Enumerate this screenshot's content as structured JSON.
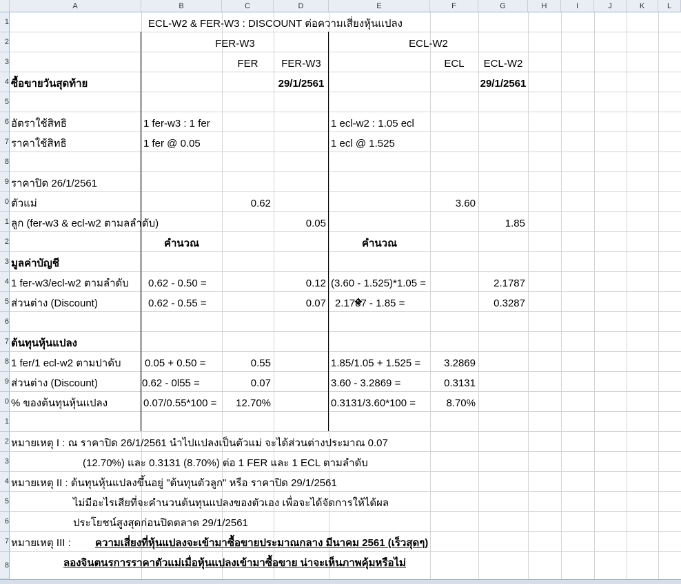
{
  "columns": [
    "A",
    "B",
    "C",
    "D",
    "E",
    "F",
    "G",
    "H",
    "I",
    "J",
    "K",
    "L"
  ],
  "rows": [
    "1",
    "2",
    "3",
    "4",
    "5",
    "6",
    "7",
    "8",
    "9",
    "0",
    "1",
    "2",
    "3",
    "4",
    "5",
    "6",
    "7",
    "8",
    "9",
    "0",
    "1",
    "2",
    "3",
    "4",
    "5",
    "6",
    "7",
    "8"
  ],
  "cells": {
    "title": "ECL-W2 & FER-W3 : DISCOUNT ต่อความเสี่ยงหุ้นแปลง",
    "fer_w3_group": "FER-W3",
    "ecl_w2_group": "ECL-W2",
    "fer_hdr": "FER",
    "fer_w3_hdr": "FER-W3",
    "ecl_hdr": "ECL",
    "ecl_w2_hdr": "ECL-W2",
    "last_trade_label": "ซื้อขายวันสุดท้าย",
    "last_trade_fer": "29/1/2561",
    "last_trade_ecl": "29/1/2561",
    "ratio_label": "อัตราใช้สิทธิ",
    "ratio_fer": "1 fer-w3 : 1 fer",
    "ratio_ecl": "1 ecl-w2 : 1.05 ecl",
    "price_label": "ราคาใช้สิทธิ",
    "price_fer": "1 fer @ 0.05",
    "price_ecl": "1 ecl @ 1.525",
    "close_label": "ราคาปิด   26/1/2561",
    "mother_label": "ตัวแม่",
    "mother_fer": "0.62",
    "mother_ecl": "3.60",
    "child_label": "ลูก   (fer-w3 & ecl-w2 ตามลลำดับ)",
    "child_fer": "0.05",
    "child_ecl": "1.85",
    "calc_fer": "คำนวณ",
    "calc_ecl": "คำนวณ",
    "book_label": "มูลค่าบัญชี",
    "book_row_label": "1 fer-w3/ecl-w2 ตามลำดับ",
    "book_fer_formula": "0.62 -  0.50   =",
    "book_fer_val": "0.12",
    "book_ecl_formula": "(3.60 - 1.525)*1.05 =",
    "book_ecl_val": "2.1787",
    "disc_label": "ส่วนต่าง   (Discount)",
    "disc_fer_formula": "0.62 - 0.55   =",
    "disc_fer_val": "0.07",
    "disc_ecl_formula": "2.1787 - 1.85       =",
    "disc_ecl_val": "0.3287",
    "cost_label": "ต้นทุนหุ้นแปลง",
    "cost_row_label": "1 fer/1 ecl-w2 ตามปาดับ",
    "cost_fer_formula": "0.05 + 0.50    =",
    "cost_fer_val": "0.55",
    "cost_ecl_formula": "1.85/1.05 + 1.525 =",
    "cost_ecl_val": "3.2869",
    "disc2_label": "ส่วนต่าง   (Discount)",
    "disc2_fer_formula": "0.62 - 0l55     =",
    "disc2_fer_val": "0.07",
    "disc2_ecl_formula": "3.60 - 3.2869          =",
    "disc2_ecl_val": "0.3131",
    "pct_label": "% ของต้นทุนหุ้นแปลง",
    "pct_fer_formula": "0.07/0.55*100 =",
    "pct_fer_val": "12.70%",
    "pct_ecl_formula": "0.3131/3.60*100  =",
    "pct_ecl_val": "8.70%",
    "note1_a": "หมายเหตุ   I :  ณ    ราคาปิด   26/1/2561 นำไปแปลงเป็นตัวแม่   จะได้ส่วนต่างประมาณ   0.07",
    "note1_b": "(12.70%) และ   0.3131 (8.70%)  ต่อ   1 FER  และ   1 ECL ตามลำดับ",
    "note2_a": "หมายเหตุ   II :  ต้นทุนหุ้นแปลงขึ้นอยู่   \"ต้นทุนตัวลูก\"  หรือ   ราคาปิด   29/1/2561",
    "note2_b": "ไม่มีอะไรเสียที่จะคำนวนต้นทุนแปลงของตัวเอง   เพื่อจะได้จัดการให้ได้ผล",
    "note2_c": "ประโยชน์สูงสุดก่อนปิดตลาด   29/1/2561",
    "note3_prefix": "หมายเหตุ   III :",
    "note3_a": "ความเสี่ยงที่หุ้นแปลงจะเข้ามาซื้อขายประมาณกลาง มีนาคม 2561 (เร็วสุดๆ)",
    "note3_b": "ลองจินตนรการราคาตัวแม่เมื่อหุ้นแปลงเข้ามาซื้อขาย น่าจะเห็นภาพคุ้มหรือไม่"
  }
}
